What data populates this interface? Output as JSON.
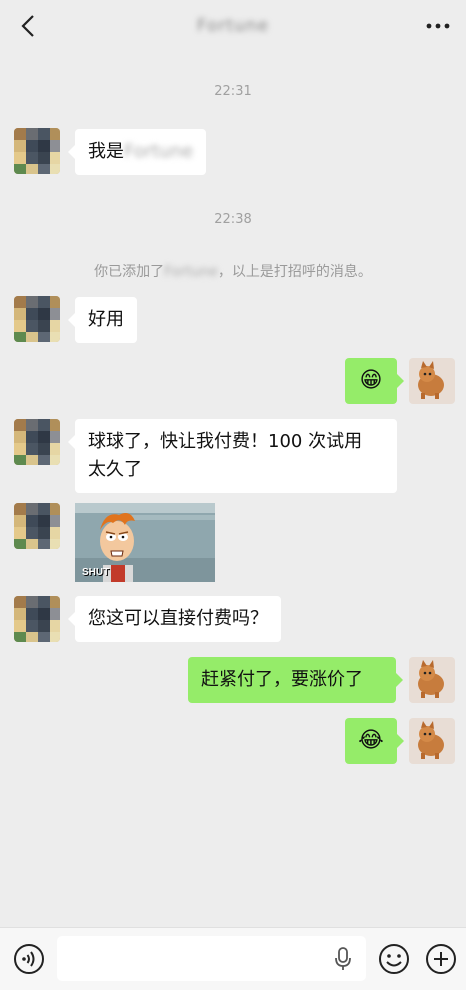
{
  "header": {
    "title": "Fortune"
  },
  "messages": {
    "time1": "22:31",
    "intro_prefix": "我是",
    "intro_name": "Fortune",
    "time2": "22:38",
    "sys_prefix": "你已添加了",
    "sys_name": "Fortune",
    "sys_suffix": "，以上是打招呼的消息。",
    "msg_good": "好用",
    "msg_pay_line1": "球球了，快让我付费！100 次试用",
    "msg_pay_line2": "太久了",
    "meme_caption": "SHUT",
    "msg_question": "您这可以直接付费吗？",
    "msg_reply": "赶紧付了，要涨价了",
    "emoji_grin": "😁",
    "emoji_laugh": "😂"
  },
  "icons": {
    "back": "chevron-left-icon",
    "more": "ellipsis-icon",
    "voice": "voice-mode-icon",
    "mic": "microphone-icon",
    "emoji": "emoji-icon",
    "plus": "plus-icon"
  },
  "colors": {
    "background": "#ededed",
    "out_bubble": "#95ec69",
    "in_bubble": "#ffffff",
    "timestamp": "#a0a0a0"
  }
}
